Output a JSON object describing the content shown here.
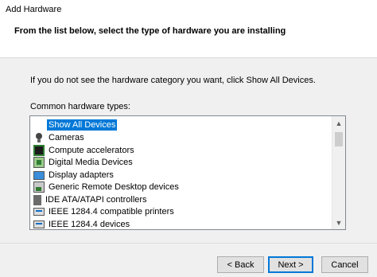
{
  "window": {
    "title": "Add Hardware"
  },
  "header": {
    "subtitle": "From the list below, select the type of hardware you are installing"
  },
  "instruction": "If you do not see the hardware category you want, click Show All Devices.",
  "list": {
    "label": "Common hardware types:",
    "items": [
      {
        "label": "Show All Devices",
        "icon": "none",
        "selected": true
      },
      {
        "label": "Cameras",
        "icon": "camera-icon"
      },
      {
        "label": "Compute accelerators",
        "icon": "chip-icon"
      },
      {
        "label": "Digital Media Devices",
        "icon": "media-device-icon"
      },
      {
        "label": "Display adapters",
        "icon": "monitor-icon"
      },
      {
        "label": "Generic Remote Desktop devices",
        "icon": "remote-desktop-icon"
      },
      {
        "label": "IDE ATA/ATAPI controllers",
        "icon": "ide-controller-icon"
      },
      {
        "label": "IEEE 1284.4 compatible printers",
        "icon": "printer-icon"
      },
      {
        "label": "IEEE 1284.4 devices",
        "icon": "printer-icon"
      }
    ]
  },
  "buttons": {
    "back": "< Back",
    "next": "Next >",
    "cancel": "Cancel"
  },
  "colors": {
    "selection": "#0078d7",
    "default_button_border": "#0078d7"
  }
}
